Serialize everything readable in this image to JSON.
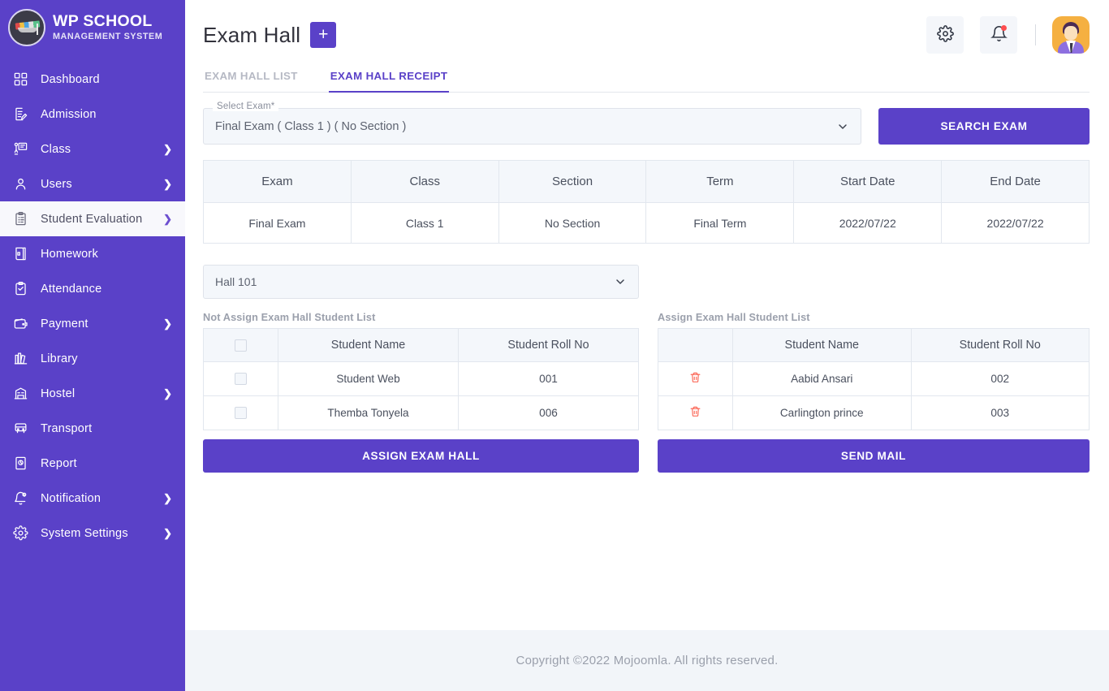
{
  "brand": {
    "title": "WP SCHOOL",
    "subtitle": "MANAGEMENT SYSTEM",
    "logo_icon": "graduation-cap-logo"
  },
  "colors": {
    "sidebar_bg": "#5a41c8",
    "accent": "#5a41c8",
    "tab_active": "#5a41c8",
    "danger": "#fb6b5b",
    "panel_bg": "#f4f7fb",
    "footer_bg": "#f2f5f9"
  },
  "sidebar": {
    "items": [
      {
        "label": "Dashboard",
        "icon": "grid-icon",
        "has_chevron": false,
        "active": false
      },
      {
        "label": "Admission",
        "icon": "document-edit-icon",
        "has_chevron": false,
        "active": false
      },
      {
        "label": "Class",
        "icon": "classroom-board-icon",
        "has_chevron": true,
        "active": false
      },
      {
        "label": "Users",
        "icon": "user-icon",
        "has_chevron": true,
        "active": false
      },
      {
        "label": "Student Evaluation",
        "icon": "clipboard-list-icon",
        "has_chevron": true,
        "active": true
      },
      {
        "label": "Homework",
        "icon": "book-icon",
        "has_chevron": false,
        "active": false
      },
      {
        "label": "Attendance",
        "icon": "clipboard-check-icon",
        "has_chevron": false,
        "active": false
      },
      {
        "label": "Payment",
        "icon": "wallet-icon",
        "has_chevron": true,
        "active": false
      },
      {
        "label": "Library",
        "icon": "books-icon",
        "has_chevron": false,
        "active": false
      },
      {
        "label": "Hostel",
        "icon": "building-icon",
        "has_chevron": true,
        "active": false
      },
      {
        "label": "Transport",
        "icon": "bus-icon",
        "has_chevron": false,
        "active": false
      },
      {
        "label": "Report",
        "icon": "report-page-icon",
        "has_chevron": false,
        "active": false
      },
      {
        "label": "Notification",
        "icon": "bell-icon",
        "has_chevron": true,
        "active": false
      },
      {
        "label": "System Settings",
        "icon": "gear-icon",
        "has_chevron": true,
        "active": false
      }
    ],
    "chevron_glyph": "❯"
  },
  "header": {
    "title": "Exam Hall",
    "add_button_label": "+",
    "settings_icon": "gear-icon",
    "notifications_icon": "bell-icon",
    "avatar_icon": "user-avatar"
  },
  "tabs": [
    {
      "label": "EXAM HALL LIST",
      "active": false
    },
    {
      "label": "EXAM HALL RECEIPT",
      "active": true
    }
  ],
  "search": {
    "legend": "Select Exam*",
    "selected_value": "Final Exam ( Class 1 ) ( No Section )",
    "button_label": "SEARCH EXAM",
    "dropdown_icon": "chevron-down-icon"
  },
  "exam_table": {
    "headers": [
      "Exam",
      "Class",
      "Section",
      "Term",
      "Start Date",
      "End Date"
    ],
    "rows": [
      [
        "Final Exam",
        "Class 1",
        "No Section",
        "Final Term",
        "2022/07/22",
        "2022/07/22"
      ]
    ]
  },
  "hall_select": {
    "selected_value": "Hall 101",
    "dropdown_icon": "chevron-down-icon"
  },
  "not_assigned": {
    "title": "Not Assign Exam Hall Student List",
    "headers": [
      "",
      "Student Name",
      "Student Roll No"
    ],
    "select_all_icon": "checkbox-icon",
    "rows": [
      {
        "name": "Student Web",
        "roll": "001",
        "icon": "checkbox-icon"
      },
      {
        "name": "Themba Tonyela",
        "roll": "006",
        "icon": "checkbox-icon"
      }
    ],
    "button_label": "ASSIGN EXAM HALL"
  },
  "assigned": {
    "title": "Assign Exam Hall Student List",
    "headers": [
      "",
      "Student Name",
      "Student Roll No"
    ],
    "rows": [
      {
        "name": "Aabid Ansari",
        "roll": "002",
        "icon": "trash-icon"
      },
      {
        "name": "Carlington prince",
        "roll": "003",
        "icon": "trash-icon"
      }
    ],
    "button_label": "SEND MAIL"
  },
  "footer": {
    "text": "Copyright ©2022 Mojoomla. All rights reserved."
  }
}
